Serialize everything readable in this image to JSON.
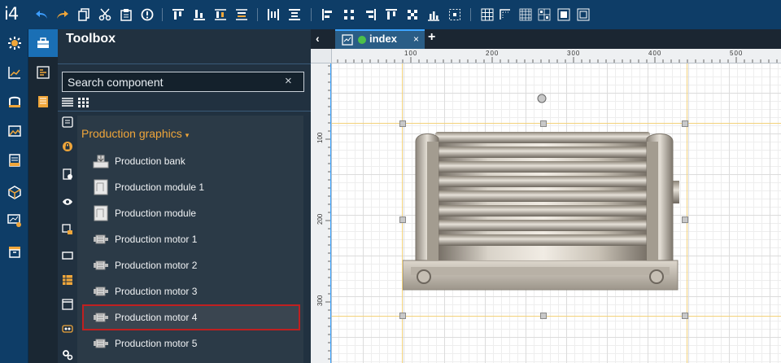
{
  "app": {
    "logo": "i4"
  },
  "toolbar": {
    "icons": [
      "undo-icon",
      "redo-icon",
      "copy-icon",
      "cut-icon",
      "paste-icon",
      "info-icon",
      "align-top-icon",
      "align-bottom-icon",
      "align-middle-icon",
      "distribute-icon",
      "align-columns-icon",
      "align-rows-icon",
      "align-left-icon",
      "align-center-icon",
      "align-right-icon",
      "align-hcenter-icon",
      "align-vcenter-icon",
      "chart-icon",
      "group-icon",
      "grid-icon",
      "grid-corner-icon",
      "grid-dense-icon",
      "grid-snap-icon",
      "grid-fill-icon",
      "grid-frame-icon"
    ]
  },
  "left_rail": {
    "icons": [
      "settings-icon",
      "chart-line-icon",
      "folder-open-icon",
      "image-icon",
      "document-icon",
      "package-icon",
      "monitor-settings-icon",
      "archive-icon"
    ]
  },
  "sub_rail": {
    "icons": [
      "toolbox-icon",
      "layers-icon",
      "notes-icon"
    ]
  },
  "toolbox": {
    "title": "Toolbox",
    "search_placeholder": "Search component",
    "clear_label": "×"
  },
  "categories": {
    "icons": [
      "list-icon",
      "lock-icon",
      "document-settings-icon",
      "eye-icon",
      "image-settings-icon",
      "rectangle-icon",
      "table-icon",
      "window-icon",
      "video-icon",
      "gears-icon"
    ]
  },
  "group": {
    "title": "Production graphics",
    "caret": "▾"
  },
  "components": [
    {
      "label": "Production bank",
      "icon": "production-bank-icon",
      "selected": false
    },
    {
      "label": "Production module 1",
      "icon": "production-module-icon",
      "selected": false
    },
    {
      "label": "Production module",
      "icon": "production-module-icon",
      "selected": false
    },
    {
      "label": "Production motor 1",
      "icon": "production-motor-icon",
      "selected": false
    },
    {
      "label": "Production motor 2",
      "icon": "production-motor-icon",
      "selected": false
    },
    {
      "label": "Production motor 3",
      "icon": "production-motor-icon",
      "selected": false
    },
    {
      "label": "Production motor 4",
      "icon": "production-motor-icon",
      "selected": true
    },
    {
      "label": "Production motor 5",
      "icon": "production-motor-icon",
      "selected": false
    }
  ],
  "editor": {
    "back_label": "‹",
    "tab": {
      "label": "index",
      "close": "×",
      "status_color": "#4cc04a"
    },
    "add_tab_label": "+",
    "ruler_h": [
      "100",
      "200",
      "300",
      "400",
      "500"
    ],
    "ruler_v": [
      "100",
      "200",
      "300"
    ]
  },
  "colors": {
    "topbar": "#0e3d67",
    "accent": "#1a6fb5",
    "group": "#f0a63a",
    "selection": "#c02020"
  }
}
